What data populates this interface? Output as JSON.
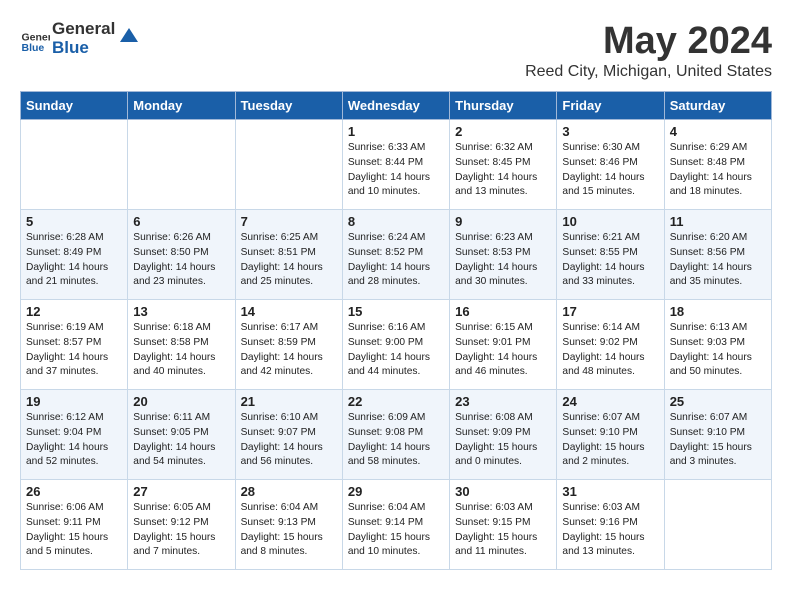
{
  "header": {
    "logo_general": "General",
    "logo_blue": "Blue",
    "month": "May 2024",
    "location": "Reed City, Michigan, United States"
  },
  "days_of_week": [
    "Sunday",
    "Monday",
    "Tuesday",
    "Wednesday",
    "Thursday",
    "Friday",
    "Saturday"
  ],
  "weeks": [
    [
      {
        "day": "",
        "info": ""
      },
      {
        "day": "",
        "info": ""
      },
      {
        "day": "",
        "info": ""
      },
      {
        "day": "1",
        "info": "Sunrise: 6:33 AM\nSunset: 8:44 PM\nDaylight: 14 hours\nand 10 minutes."
      },
      {
        "day": "2",
        "info": "Sunrise: 6:32 AM\nSunset: 8:45 PM\nDaylight: 14 hours\nand 13 minutes."
      },
      {
        "day": "3",
        "info": "Sunrise: 6:30 AM\nSunset: 8:46 PM\nDaylight: 14 hours\nand 15 minutes."
      },
      {
        "day": "4",
        "info": "Sunrise: 6:29 AM\nSunset: 8:48 PM\nDaylight: 14 hours\nand 18 minutes."
      }
    ],
    [
      {
        "day": "5",
        "info": "Sunrise: 6:28 AM\nSunset: 8:49 PM\nDaylight: 14 hours\nand 21 minutes."
      },
      {
        "day": "6",
        "info": "Sunrise: 6:26 AM\nSunset: 8:50 PM\nDaylight: 14 hours\nand 23 minutes."
      },
      {
        "day": "7",
        "info": "Sunrise: 6:25 AM\nSunset: 8:51 PM\nDaylight: 14 hours\nand 25 minutes."
      },
      {
        "day": "8",
        "info": "Sunrise: 6:24 AM\nSunset: 8:52 PM\nDaylight: 14 hours\nand 28 minutes."
      },
      {
        "day": "9",
        "info": "Sunrise: 6:23 AM\nSunset: 8:53 PM\nDaylight: 14 hours\nand 30 minutes."
      },
      {
        "day": "10",
        "info": "Sunrise: 6:21 AM\nSunset: 8:55 PM\nDaylight: 14 hours\nand 33 minutes."
      },
      {
        "day": "11",
        "info": "Sunrise: 6:20 AM\nSunset: 8:56 PM\nDaylight: 14 hours\nand 35 minutes."
      }
    ],
    [
      {
        "day": "12",
        "info": "Sunrise: 6:19 AM\nSunset: 8:57 PM\nDaylight: 14 hours\nand 37 minutes."
      },
      {
        "day": "13",
        "info": "Sunrise: 6:18 AM\nSunset: 8:58 PM\nDaylight: 14 hours\nand 40 minutes."
      },
      {
        "day": "14",
        "info": "Sunrise: 6:17 AM\nSunset: 8:59 PM\nDaylight: 14 hours\nand 42 minutes."
      },
      {
        "day": "15",
        "info": "Sunrise: 6:16 AM\nSunset: 9:00 PM\nDaylight: 14 hours\nand 44 minutes."
      },
      {
        "day": "16",
        "info": "Sunrise: 6:15 AM\nSunset: 9:01 PM\nDaylight: 14 hours\nand 46 minutes."
      },
      {
        "day": "17",
        "info": "Sunrise: 6:14 AM\nSunset: 9:02 PM\nDaylight: 14 hours\nand 48 minutes."
      },
      {
        "day": "18",
        "info": "Sunrise: 6:13 AM\nSunset: 9:03 PM\nDaylight: 14 hours\nand 50 minutes."
      }
    ],
    [
      {
        "day": "19",
        "info": "Sunrise: 6:12 AM\nSunset: 9:04 PM\nDaylight: 14 hours\nand 52 minutes."
      },
      {
        "day": "20",
        "info": "Sunrise: 6:11 AM\nSunset: 9:05 PM\nDaylight: 14 hours\nand 54 minutes."
      },
      {
        "day": "21",
        "info": "Sunrise: 6:10 AM\nSunset: 9:07 PM\nDaylight: 14 hours\nand 56 minutes."
      },
      {
        "day": "22",
        "info": "Sunrise: 6:09 AM\nSunset: 9:08 PM\nDaylight: 14 hours\nand 58 minutes."
      },
      {
        "day": "23",
        "info": "Sunrise: 6:08 AM\nSunset: 9:09 PM\nDaylight: 15 hours\nand 0 minutes."
      },
      {
        "day": "24",
        "info": "Sunrise: 6:07 AM\nSunset: 9:10 PM\nDaylight: 15 hours\nand 2 minutes."
      },
      {
        "day": "25",
        "info": "Sunrise: 6:07 AM\nSunset: 9:10 PM\nDaylight: 15 hours\nand 3 minutes."
      }
    ],
    [
      {
        "day": "26",
        "info": "Sunrise: 6:06 AM\nSunset: 9:11 PM\nDaylight: 15 hours\nand 5 minutes."
      },
      {
        "day": "27",
        "info": "Sunrise: 6:05 AM\nSunset: 9:12 PM\nDaylight: 15 hours\nand 7 minutes."
      },
      {
        "day": "28",
        "info": "Sunrise: 6:04 AM\nSunset: 9:13 PM\nDaylight: 15 hours\nand 8 minutes."
      },
      {
        "day": "29",
        "info": "Sunrise: 6:04 AM\nSunset: 9:14 PM\nDaylight: 15 hours\nand 10 minutes."
      },
      {
        "day": "30",
        "info": "Sunrise: 6:03 AM\nSunset: 9:15 PM\nDaylight: 15 hours\nand 11 minutes."
      },
      {
        "day": "31",
        "info": "Sunrise: 6:03 AM\nSunset: 9:16 PM\nDaylight: 15 hours\nand 13 minutes."
      },
      {
        "day": "",
        "info": ""
      }
    ]
  ]
}
